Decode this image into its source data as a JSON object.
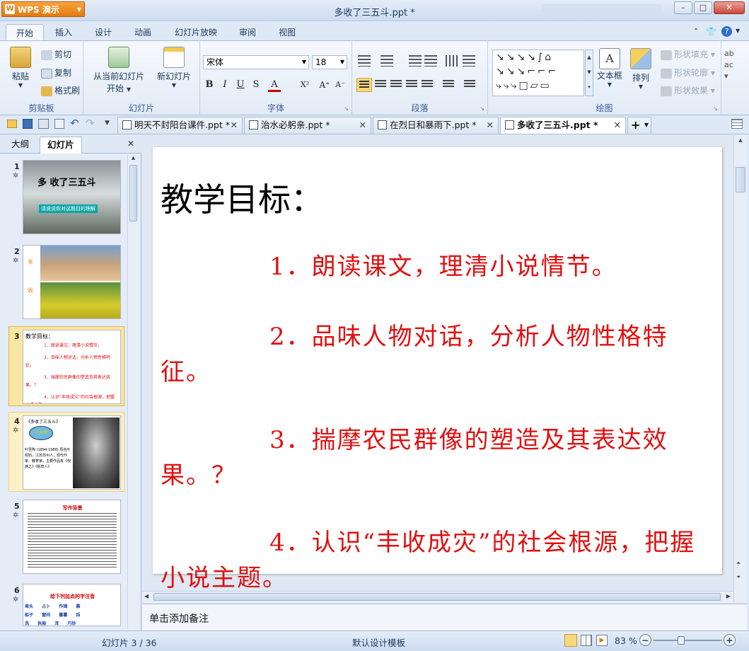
{
  "app": {
    "name": "WPS 演示",
    "window_title": "多收了三五斗.ppt *"
  },
  "window_controls": {
    "minimize": "–",
    "restore": "□",
    "close": "✕"
  },
  "menu_tabs": [
    "开始",
    "插入",
    "设计",
    "动画",
    "幻灯片放映",
    "审阅",
    "视图"
  ],
  "menu_right_icons": [
    "chevron-up-icon",
    "skin-icon",
    "help-icon"
  ],
  "ribbon": {
    "clipboard": {
      "paste": "粘贴",
      "cut": "剪切",
      "copy": "复制",
      "format_painter": "格式刷",
      "group": "剪贴板"
    },
    "slides": {
      "from_current_line1": "从当前幻灯片",
      "from_current_line2": "开始",
      "new_slide": "新幻灯片",
      "group": "幻灯片"
    },
    "font": {
      "family": "宋体",
      "size": "18",
      "group": "字体",
      "bold": "B",
      "italic": "I",
      "underline": "U",
      "shadow": "S",
      "color": "A",
      "superscript": "X²",
      "grow": "A⁺",
      "shrink": "A⁻"
    },
    "paragraph": {
      "group": "段落"
    },
    "drawing": {
      "textbox": "文本框",
      "arrange": "排列",
      "shape_fill": "形状填充",
      "shape_outline": "形状轮廓",
      "shape_effect": "形状效果",
      "group": "绘图"
    }
  },
  "doc_tabs": [
    {
      "label": "明天不封阳台课件.ppt *",
      "active": false
    },
    {
      "label": "治水必躬亲.ppt *",
      "active": false
    },
    {
      "label": "在烈日和暴雨下.ppt *",
      "active": false
    },
    {
      "label": "多收了三五斗.ppt *",
      "active": true
    }
  ],
  "doc_tab_add": "+",
  "left_panel": {
    "tab_outline": "大纲",
    "tab_slides": "幻灯片",
    "close": "✕",
    "thumbs": [
      {
        "num": "1",
        "title": "多 收了三五斗",
        "caption": "请说说你对这题目的理解"
      },
      {
        "num": "2",
        "text_top": "丰",
        "text_bottom": "收"
      },
      {
        "num": "3",
        "title": "教学目标：",
        "lines": [
          "1．朗读课文，理清小说情节。",
          "2．品味人物对话，分析人物性格特征。",
          "3．揣摩农民群像的塑造及其表达效果。？",
          "4．认识“丰收成灾”的社会根源，把握小说主题。"
        ]
      },
      {
        "num": "4",
        "title": "《多收了三五斗》",
        "badge": "叶圣陶",
        "body": "叶圣陶 (1894-1988) 原名叶绍钧，江苏苏州人，现代作家、教育家。主要作品有《倪焕之》《稻草人》"
      },
      {
        "num": "5",
        "title": "写作背景",
        "body": "1933年前后的中国农村，帝国主义经济侵略和封建剥削导致谷贱伤农……"
      },
      {
        "num": "6",
        "title": "给下列加点的字注音",
        "words": [
          "埠头",
          "占卜",
          "作揖",
          "晨",
          "船子",
          "窗间",
          "蕃薯",
          "舀",
          "洗",
          "执拗",
          "浑",
          "巧妙"
        ]
      }
    ]
  },
  "slide": {
    "title": "教学目标：",
    "items": [
      "1．朗读课文，理清小说情节。",
      "2．品味人物对话，分析人物性格特征。",
      "3．揣摩农民群像的塑造及其表达效果。？",
      "4．认识“丰收成灾”的社会根源，把握小说主题。"
    ],
    "title_color": "#000000",
    "body_color": "#e01010"
  },
  "notes_placeholder": "单击添加备注",
  "status": {
    "slide_counter": "幻灯片 3 / 36",
    "template": "默认设计模板",
    "zoom": "83 %"
  },
  "colors": {
    "accent": "#f08a24",
    "ribbon_bg": "#e2ebf6",
    "selected_thumb": "#f8e7a4"
  }
}
